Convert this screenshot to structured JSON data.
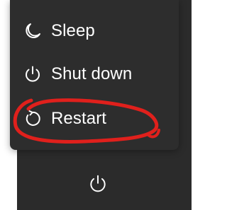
{
  "power_menu": {
    "items": [
      {
        "label": "Sleep",
        "icon": "moon-icon"
      },
      {
        "label": "Shut down",
        "icon": "power-icon"
      },
      {
        "label": "Restart",
        "icon": "restart-icon"
      }
    ]
  },
  "taskbar": {
    "power_button_icon": "power-icon"
  },
  "annotation": {
    "color": "#e0201c",
    "marks": "Restart"
  },
  "colors": {
    "menu_background": "#2d2d2d",
    "text": "#ffffff"
  }
}
